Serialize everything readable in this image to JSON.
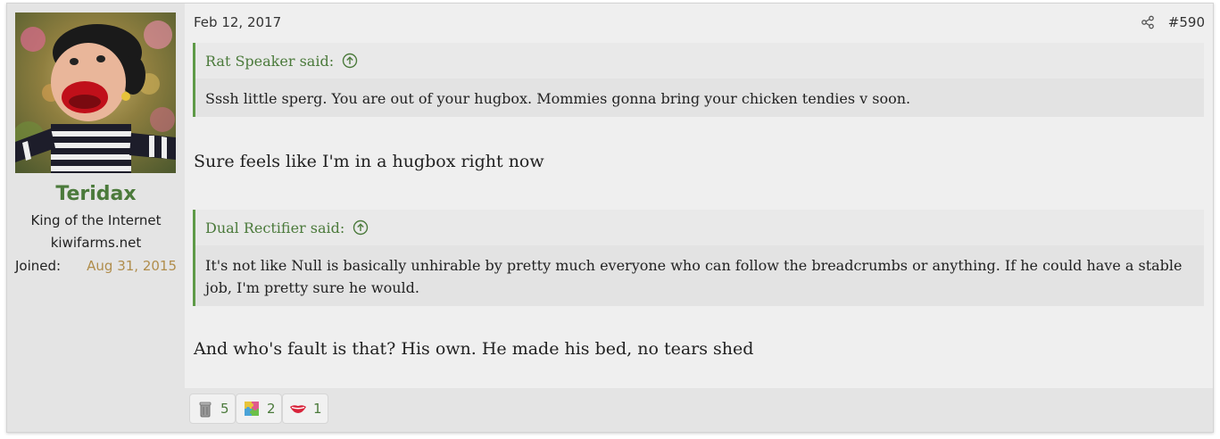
{
  "post": {
    "date": "Feb 12, 2017",
    "number": "#590",
    "share_icon": "share-icon"
  },
  "user": {
    "name": "Teridax",
    "title": "King of the Internet",
    "subtitle": "kiwifarms.net",
    "joined_label": "Joined:",
    "joined_value": "Aug 31, 2015",
    "name_color": "#4b7a3b"
  },
  "quotes": [
    {
      "author": "Rat Speaker said:",
      "text": "Sssh little sperg. You are out of your hugbox. Mommies gonna bring your chicken tendies v soon."
    },
    {
      "author": "Dual Rectifier said:",
      "text": "It's not like Null is basically unhirable by pretty much everyone who can follow the breadcrumbs or anything. If he could have a stable job, I'm pretty sure he would."
    }
  ],
  "messages": [
    "Sure feels like I'm in a hugbox right now",
    "And who's fault is that? His own. He made his bed, no tears shed"
  ],
  "reactions": [
    {
      "icon": "trash-can-icon",
      "count": "5"
    },
    {
      "icon": "puzzle-piece-icon",
      "count": "2"
    },
    {
      "icon": "lips-icon",
      "count": "1"
    }
  ],
  "colors": {
    "accent": "#4b7a3b",
    "quote_border": "#5e9a47",
    "joined_date": "#b08d4c"
  }
}
